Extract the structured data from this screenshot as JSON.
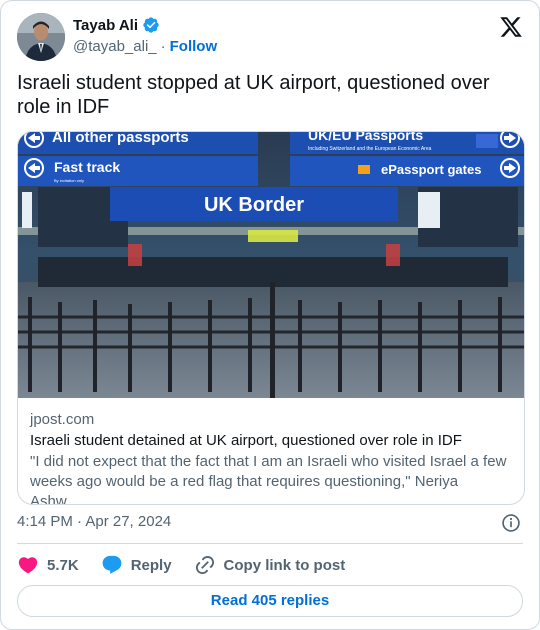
{
  "author": {
    "display_name": "Tayab Ali",
    "handle": "@tayab_ali_",
    "separator": "·",
    "follow_label": "Follow",
    "verified": true
  },
  "tweet": {
    "text": "Israeli student stopped at UK airport, questioned over role in IDF",
    "timestamp": "4:14 PM · Apr 27, 2024"
  },
  "card": {
    "domain": "jpost.com",
    "title": "Israeli student detained at UK airport, questioned over role in IDF",
    "description": "\"I did not expect that the fact that I am an Israeli who visited Israel a few weeks ago would be a red flag that requires questioning,\" Neriya Ashw…",
    "image_signs": {
      "all_other": "All other passports",
      "uk_eu": "UK/EU Passports",
      "uk_eu_sub": "Including Switzerland and the European Economic Area",
      "fast_track": "Fast track",
      "fast_track_sub": "By invitation only",
      "epassport": "ePassport gates",
      "uk_border": "UK Border"
    }
  },
  "actions": {
    "likes": "5.7K",
    "reply_label": "Reply",
    "copy_label": "Copy link to post"
  },
  "read_replies": "Read 405 replies",
  "colors": {
    "accent": "#006fd6",
    "heart": "#f91880",
    "reply": "#1d9bf0",
    "verified": "#1d9bf0"
  }
}
